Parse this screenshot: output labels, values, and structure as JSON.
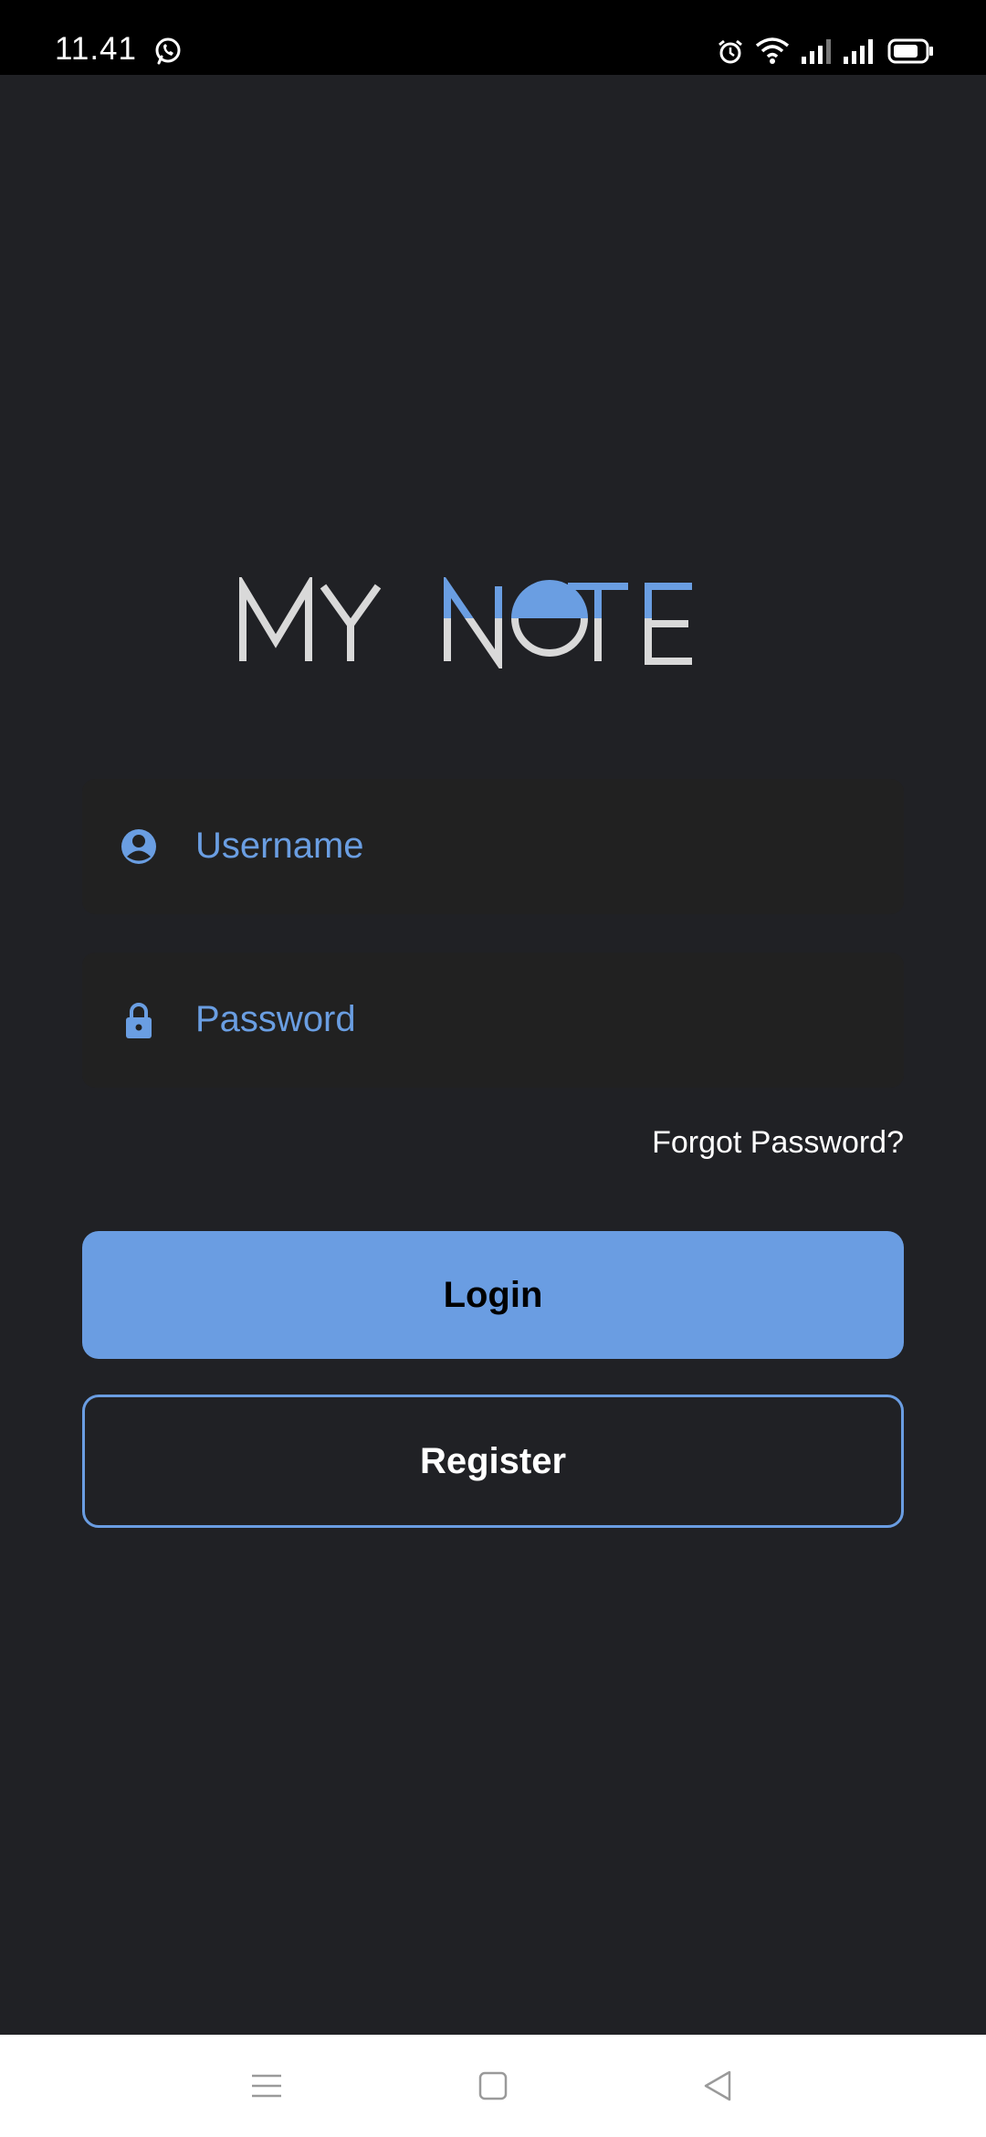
{
  "status_bar": {
    "time": "11.41",
    "icons": [
      "whatsapp-icon",
      "alarm-icon",
      "wifi-icon",
      "signal-icon",
      "signal-icon",
      "battery-icon"
    ]
  },
  "logo": {
    "text": "MY NOTE",
    "colors": {
      "light": "#d9d9d9",
      "accent": "#6a9ee2"
    }
  },
  "login_form": {
    "username_placeholder": "Username",
    "password_placeholder": "Password",
    "forgot_label": "Forgot Password?",
    "login_label": "Login",
    "register_label": "Register"
  },
  "nav_bar": {
    "icons": [
      "menu-icon",
      "home-icon",
      "back-icon"
    ]
  },
  "colors": {
    "background": "#202125",
    "field_background": "#212121",
    "accent": "#6a9de2",
    "status_bar": "#000000",
    "nav_bar": "#ffffff"
  }
}
